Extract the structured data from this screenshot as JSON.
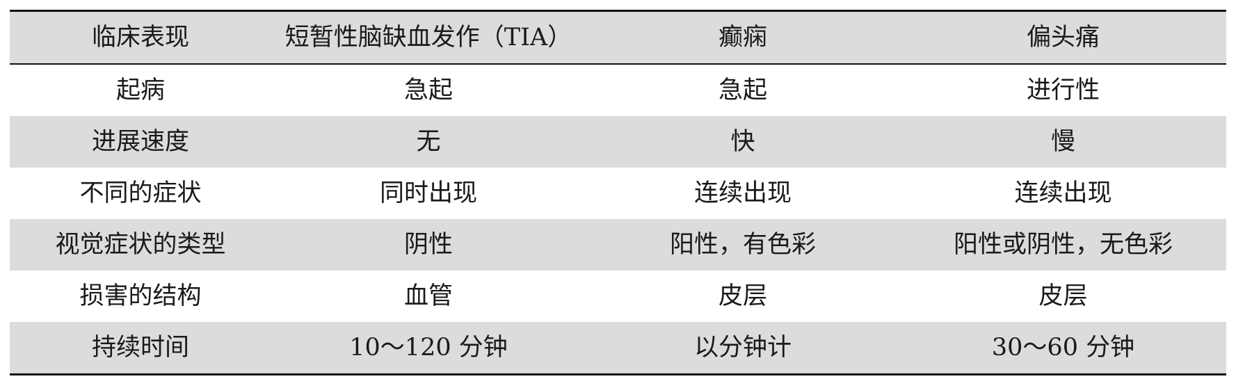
{
  "table": {
    "headers": [
      "临床表现",
      "短暂性脑缺血发作（TIA）",
      "癫痫",
      "偏头痛"
    ],
    "rows": [
      [
        "起病",
        "急起",
        "急起",
        "进行性"
      ],
      [
        "进展速度",
        "无",
        "快",
        "慢"
      ],
      [
        "不同的症状",
        "同时出现",
        "连续出现",
        "连续出现"
      ],
      [
        "视觉症状的类型",
        "阴性",
        "阳性，有色彩",
        "阳性或阴性，无色彩"
      ],
      [
        "损害的结构",
        "血管",
        "皮层",
        "皮层"
      ],
      [
        "持续时间",
        "10～120 分钟",
        "以分钟计",
        "30～60 分钟"
      ]
    ]
  },
  "colors": {
    "shaded_row": "#dcdcdc",
    "plain_row": "#ffffff",
    "rule": "#111111"
  }
}
